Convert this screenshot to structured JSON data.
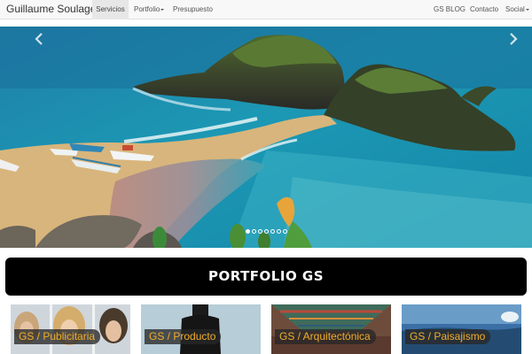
{
  "navbar": {
    "brand": "Guillaume Soulages",
    "left_items": [
      {
        "label": "Servicios",
        "active": true
      },
      {
        "label": "Portfolio",
        "dropdown": true
      },
      {
        "label": "Presupuesto"
      }
    ],
    "right_items": [
      {
        "label": "GS BLOG"
      },
      {
        "label": "Contacto"
      },
      {
        "label": "Social",
        "dropdown": true
      }
    ]
  },
  "carousel": {
    "slide_count": 7,
    "active_slide": 1,
    "icons": {
      "prev": "chevron-left-icon",
      "next": "chevron-right-icon"
    }
  },
  "portfolio": {
    "title": "PORTFOLIO GS",
    "tiles": [
      {
        "label": "GS / Publicitaria"
      },
      {
        "label": "GS / Producto"
      },
      {
        "label": "GS / Arquitectónica"
      },
      {
        "label": "GS / Paisajismo"
      }
    ]
  },
  "colors": {
    "navbar_bg": "#f8f8f8",
    "banner_bg": "#000000",
    "tile_label_text": "#f0ad2a"
  }
}
